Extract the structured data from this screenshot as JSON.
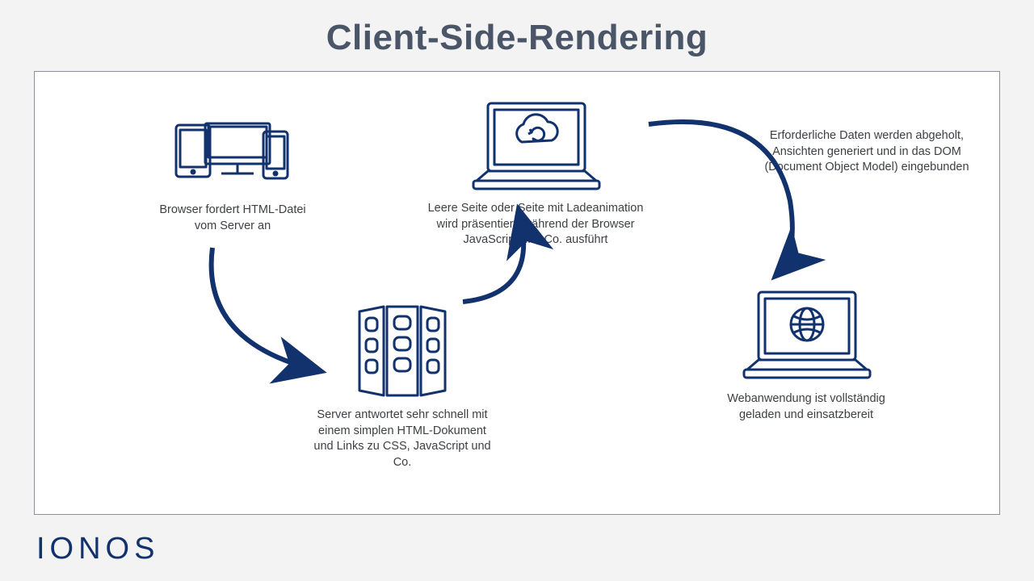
{
  "title": "Client-Side-Rendering",
  "logo": "IONOS",
  "colors": {
    "title": "#4a5568",
    "icon": "#12326e",
    "text": "#3c3f44",
    "border": "#8a8f9a",
    "background": "#f3f3f3"
  },
  "nodes": {
    "browser_request": {
      "caption": "Browser fordert HTML-Datei vom Server an"
    },
    "server_response": {
      "caption": "Server antwortet sehr schnell mit einem simplen HTML-Dokument und Links zu CSS, JavaScript und Co."
    },
    "loading_page": {
      "caption": "Leere Seite oder Seite mit Ladeanimation wird präsentiert, während der Browser JavaScript und Co. ausführt"
    },
    "dom_binding": {
      "caption": "Erforderliche Daten werden abgeholt, Ansichten generiert und in das DOM (Document Object Model) eingebunden"
    },
    "loaded_app": {
      "caption": "Webanwendung ist vollständig geladen und einsatzbereit"
    }
  }
}
